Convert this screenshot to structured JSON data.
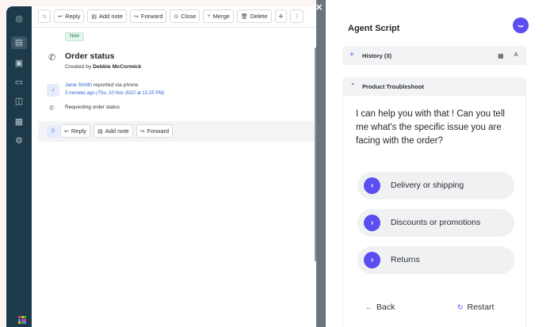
{
  "toolbar": {
    "star": "☆",
    "reply": "Reply",
    "add_note": "Add note",
    "forward": "Forward",
    "close": "Close",
    "merge": "Merge",
    "delete": "Delete",
    "more": "⋮"
  },
  "ticket": {
    "status_badge": "New",
    "title": "Order status",
    "created_prefix": "Created by",
    "created_by": "Debbie McCormick",
    "reporter_avatar": "J",
    "reporter_name": "Jane Smith",
    "reporter_suffix": "reported via phone",
    "reported_time": "5 minutes ago (Thu, 10 Nov 2022 at 12:25 PM)",
    "request_text": "Requesting order status",
    "reply_avatar": "D"
  },
  "reply_bar": {
    "reply": "Reply",
    "add_note": "Add note",
    "forward": "Forward"
  },
  "agent_script": {
    "title": "Agent Script",
    "history_label": "History (3)",
    "history_view": "A",
    "section_label": "Product Troubleshoot",
    "question": "I can help you with that ! Can you tell me what's the specific issue you are facing with the order?",
    "options": [
      {
        "label": "Delivery or shipping"
      },
      {
        "label": "Discounts or promotions"
      },
      {
        "label": "Returns"
      }
    ],
    "back_label": "Back",
    "restart_label": "Restart"
  },
  "colors": {
    "accent": "#5b4df0",
    "sidebar": "#1d3a4a",
    "link": "#2f5fd0"
  }
}
